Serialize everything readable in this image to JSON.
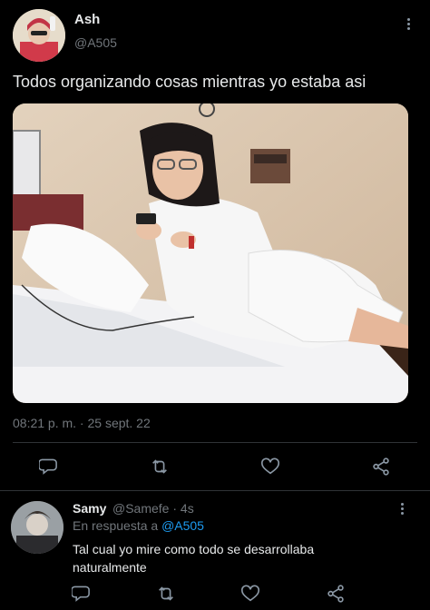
{
  "tweet": {
    "author": {
      "name": "Ash",
      "handle": "@A505"
    },
    "text": "Todos organizando cosas mientras yo estaba asi",
    "timestamp": "08:21 p. m. · 25 sept. 22",
    "media_alt": "photo"
  },
  "reply": {
    "author": {
      "name": "Samy",
      "handle": "@Samefe"
    },
    "age": "4s",
    "replying_to_prefix": "En respuesta a",
    "replying_to_handle": "@A505",
    "text_line1": "Tal cual yo mire como todo se desarrollaba",
    "text_line2": "naturalmente"
  },
  "icons": {
    "reply": "reply-icon",
    "retweet": "retweet-icon",
    "like": "heart-icon",
    "share": "share-icon",
    "more": "more-icon"
  },
  "colors": {
    "background": "#000000",
    "text": "#e7e9ea",
    "muted": "#71767b",
    "link": "#1d9bf0",
    "divider": "#2f3336"
  }
}
